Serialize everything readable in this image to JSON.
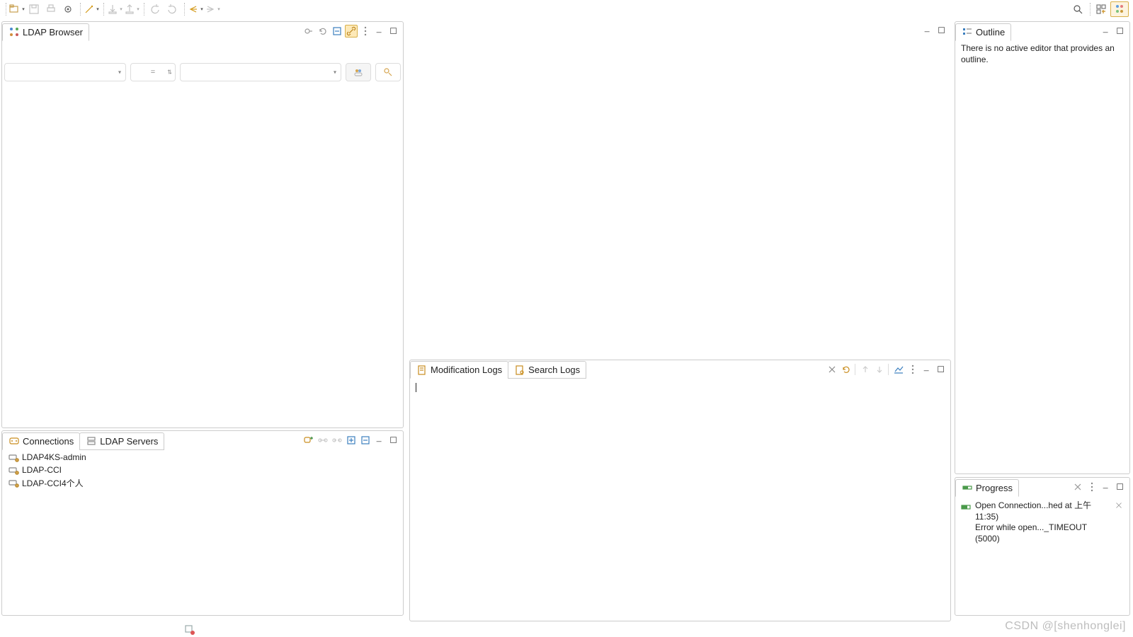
{
  "ldap_browser": {
    "title": "LDAP Browser",
    "filter_op": "="
  },
  "connections": {
    "tab1": "Connections",
    "tab2": "LDAP Servers",
    "items": [
      {
        "label": "LDAP4KS-admin"
      },
      {
        "label": "LDAP-CCI"
      },
      {
        "label": "LDAP-CCI4个人"
      }
    ]
  },
  "logs": {
    "tab1": "Modification Logs",
    "tab2": "Search Logs"
  },
  "outline": {
    "title": "Outline",
    "empty": "There is no active editor that provides an outline."
  },
  "progress": {
    "title": "Progress",
    "line1": "Open Connection...hed at 上午 11:35)",
    "line2": "Error while open..._TIMEOUT (5000)"
  },
  "watermark": "CSDN @[shenhonglei]"
}
